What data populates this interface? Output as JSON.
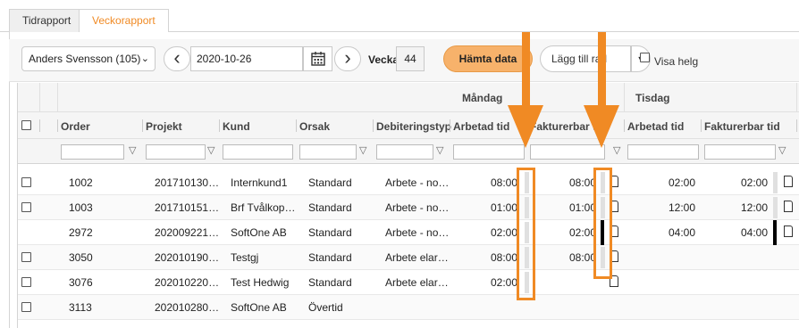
{
  "tabs": [
    {
      "label": "Tidrapport",
      "active": false
    },
    {
      "label": "Veckorapport",
      "active": true
    }
  ],
  "toolbar": {
    "employee": "Anders Svensson (105)",
    "date": "2020-10-26",
    "week_label": "Vecka",
    "week_number": "44",
    "fetch_label": "Hämta data",
    "add_row_label": "Lägg till rad",
    "show_weekend_label": "Visa helg"
  },
  "grid": {
    "day_groups": [
      "Måndag",
      "Tisdag"
    ],
    "columns": [
      "Order",
      "Projekt",
      "Kund",
      "Orsak",
      "Debiteringstyp",
      "Arbetad tid",
      "Fakturerbar tid",
      "Arbetad tid",
      "Fakturerbar tid"
    ],
    "rows": [
      {
        "order": "1002",
        "projekt": "201710130…",
        "kund": "Internkund1",
        "orsak": "Standard",
        "deb": "Arbete - no…",
        "mon_arb": "08:00",
        "mon_fakt": "08:00",
        "tue_arb": "02:00",
        "tue_fakt": "02:00",
        "checkbox": true
      },
      {
        "order": "1003",
        "projekt": "201710151…",
        "kund": "Brf Tvålkop…",
        "orsak": "Standard",
        "deb": "Arbete - no…",
        "mon_arb": "01:00",
        "mon_fakt": "01:00",
        "tue_arb": "12:00",
        "tue_fakt": "12:00",
        "checkbox": true
      },
      {
        "order": "2972",
        "projekt": "202009221…",
        "kund": "SoftOne AB",
        "orsak": "Standard",
        "deb": "Arbete - no…",
        "mon_arb": "02:00",
        "mon_fakt": "02:00",
        "tue_arb": "04:00",
        "tue_fakt": "04:00",
        "checkbox": false
      },
      {
        "order": "3050",
        "projekt": "202010190…",
        "kund": "Testgj",
        "orsak": "Standard",
        "deb": "Arbete elar…",
        "mon_arb": "08:00",
        "mon_fakt": "08:00",
        "tue_arb": "",
        "tue_fakt": "",
        "checkbox": true
      },
      {
        "order": "3076",
        "projekt": "202010220…",
        "kund": "Test Hedwig",
        "orsak": "Standard",
        "deb": "Arbete elar…",
        "mon_arb": "02:00",
        "mon_fakt": "",
        "tue_arb": "",
        "tue_fakt": "",
        "checkbox": true
      },
      {
        "order": "3113",
        "projekt": "202010280…",
        "kund": "SoftOne AB",
        "orsak": "Övertid",
        "deb": "",
        "mon_arb": "",
        "mon_fakt": "",
        "tue_arb": "",
        "tue_fakt": "",
        "checkbox": true
      }
    ]
  },
  "colors": {
    "accent": "#f08a24",
    "fetch_button": "#f7b26b"
  }
}
